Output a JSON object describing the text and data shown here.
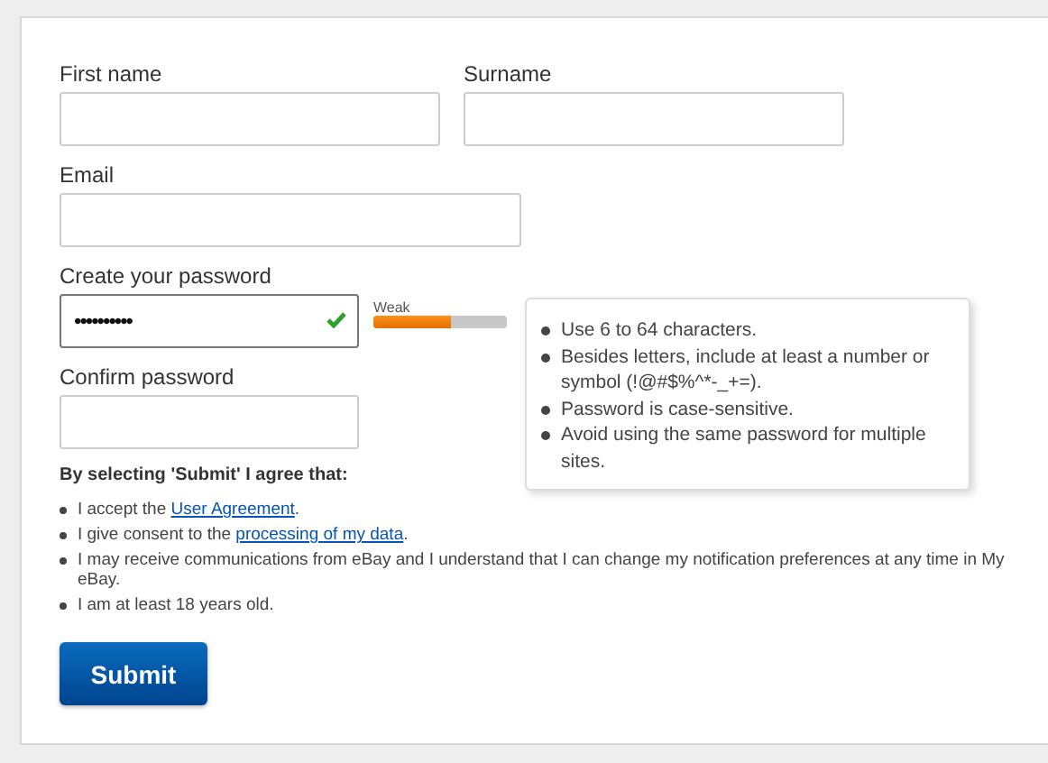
{
  "fields": [
    {
      "label": "First name"
    },
    {
      "label": "Surname"
    },
    {
      "label": "Email"
    },
    {
      "label": "Create your password",
      "value": "••••••••••",
      "focused": true,
      "valid": true,
      "strength": {
        "label": "Weak",
        "level": 0.58
      }
    },
    {
      "label": "Confirm password"
    }
  ],
  "tips": [
    "Use 6 to 64 characters.",
    "Besides letters, include at least a number or symbol (!@#$%^*-_+=).",
    "Password is case-sensitive.",
    "Avoid using the same password for multiple sites."
  ],
  "agreement": {
    "heading": "By selecting 'Submit' I agree that:",
    "items": [
      {
        "before": "I accept the ",
        "link": "User Agreement",
        "after": "."
      },
      {
        "before": "I give consent to the ",
        "link": "processing of my data",
        "after": "."
      },
      {
        "before": "I may receive communications from eBay and I understand that I can change my notification preferences at any time in My eBay."
      },
      {
        "before": "I am at least 18 years old."
      }
    ]
  },
  "submit": "Submit"
}
